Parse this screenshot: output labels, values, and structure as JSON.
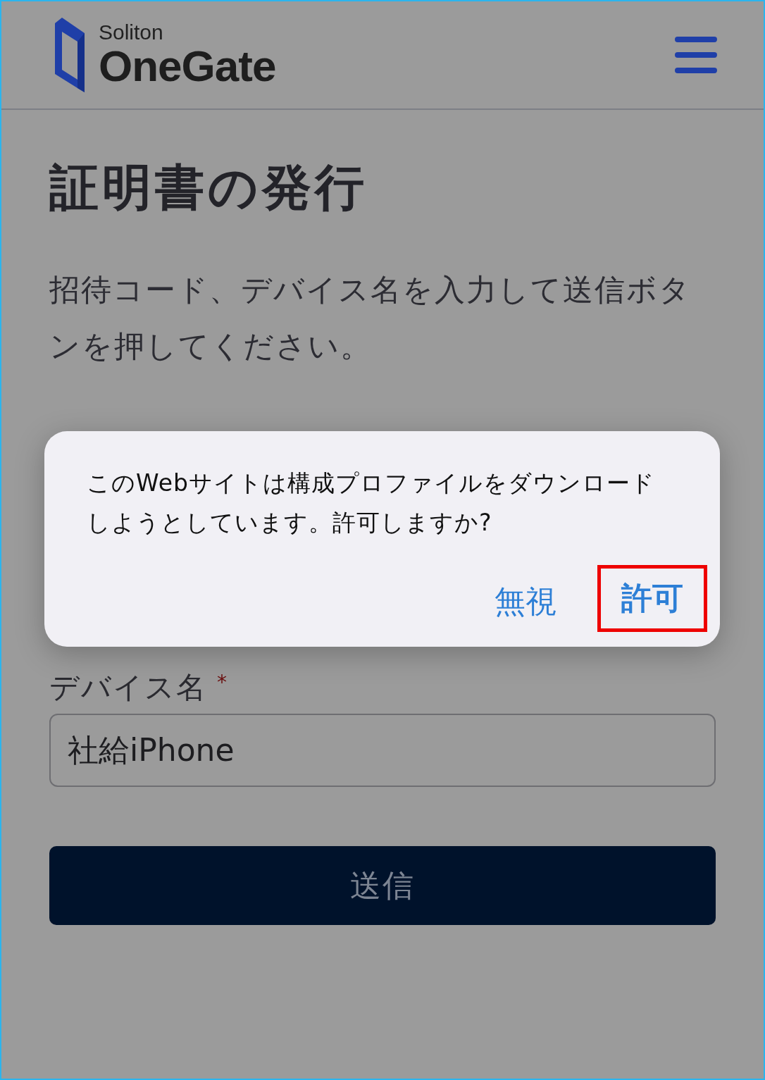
{
  "header": {
    "brand_small": "Soliton",
    "brand": "OneGate"
  },
  "page": {
    "title": "証明書の発行",
    "instructions": "招待コード、デバイス名を入力して送信ボタンを押してください。"
  },
  "fields": [
    {
      "label": "デバイス名",
      "required_mark": "*",
      "value": "社給iPhone"
    }
  ],
  "submit": {
    "label": "送信"
  },
  "dialog": {
    "message": "このWebサイトは構成プロファイルをダウンロードしようとしています。許可しますか?",
    "buttons": [
      {
        "label": "無視",
        "kind": "cancel",
        "highlighted": false
      },
      {
        "label": "許可",
        "kind": "confirm",
        "highlighted": true
      }
    ]
  }
}
